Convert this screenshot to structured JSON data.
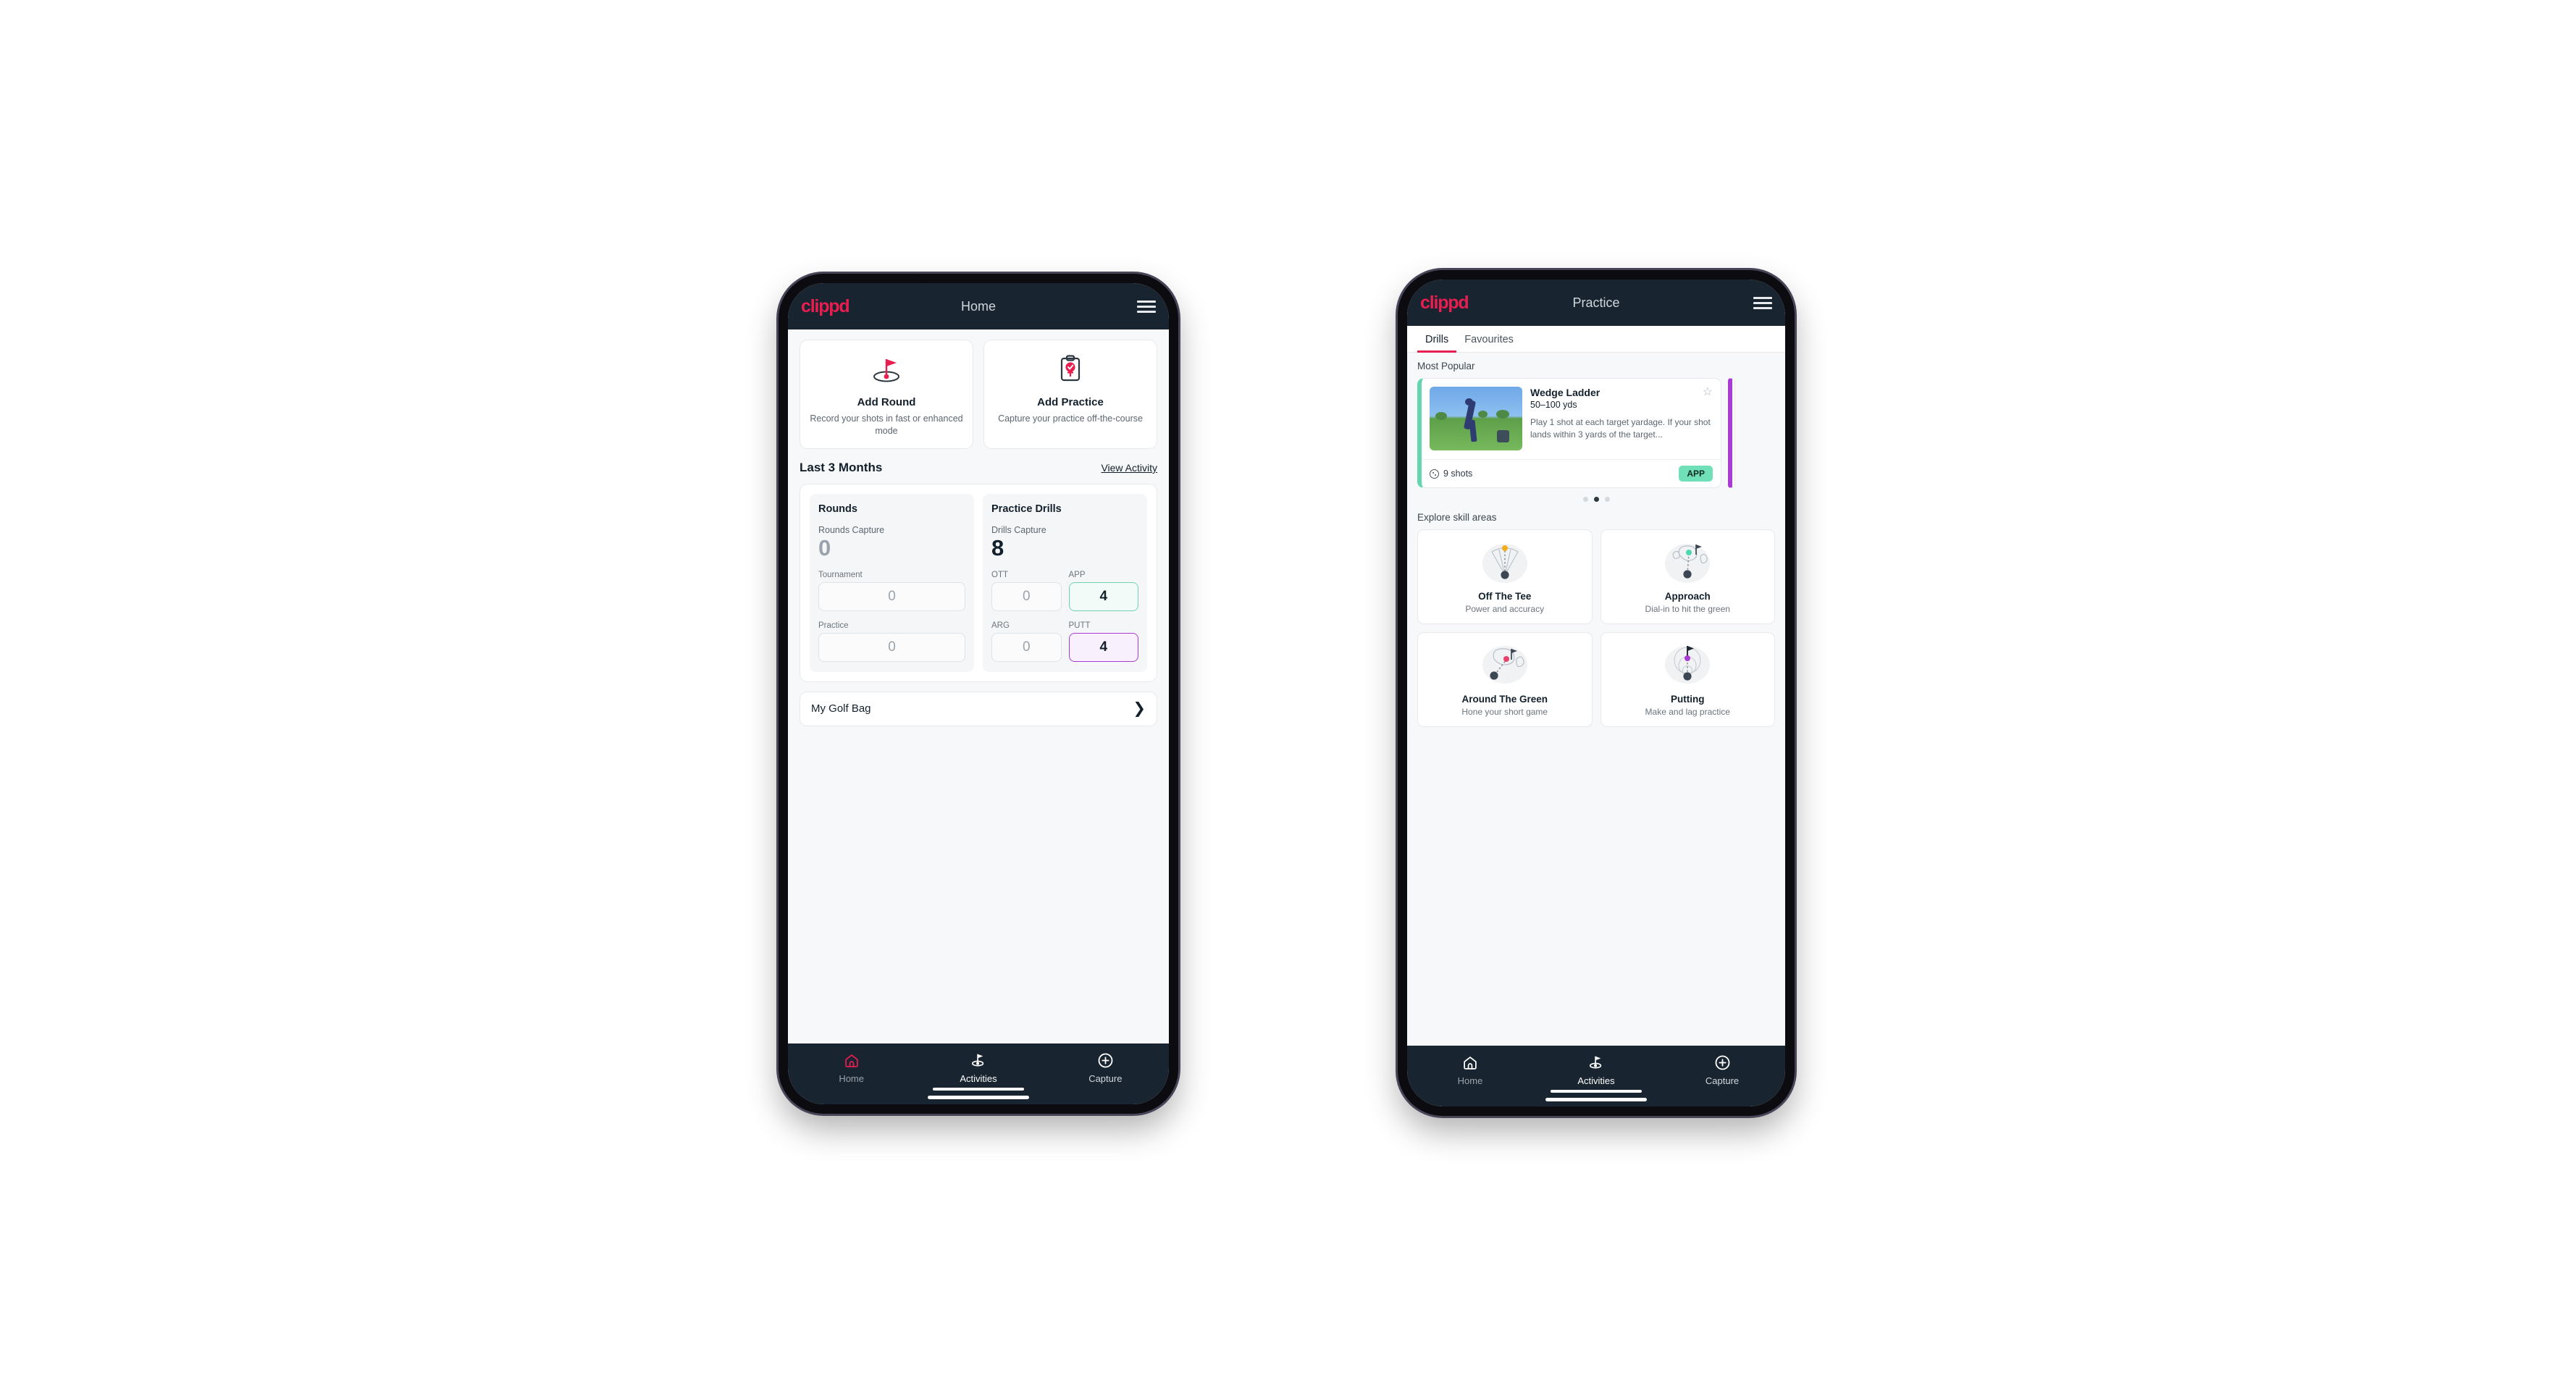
{
  "brand": {
    "logo_text": "clippd",
    "accent": "#e81e50",
    "dark": "#18242f"
  },
  "phone1": {
    "appbar": {
      "title": "Home",
      "menu_icon": "hamburger-icon"
    },
    "quick_actions": [
      {
        "icon": "golf-flag-hole-icon",
        "title": "Add Round",
        "subtitle": "Record your shots in fast or enhanced mode"
      },
      {
        "icon": "clipboard-check-icon",
        "title": "Add Practice",
        "subtitle": "Capture your practice off-the-course"
      }
    ],
    "section": {
      "title": "Last 3 Months",
      "link": "View Activity"
    },
    "rounds": {
      "heading": "Rounds",
      "caption": "Rounds Capture",
      "value": "0",
      "fields": [
        {
          "label": "Tournament",
          "value": "0",
          "state": "empty"
        },
        {
          "label": "Practice",
          "value": "0",
          "state": "empty"
        }
      ]
    },
    "drills": {
      "heading": "Practice Drills",
      "caption": "Drills Capture",
      "value": "8",
      "fields": [
        {
          "label": "OTT",
          "value": "0",
          "state": "empty"
        },
        {
          "label": "APP",
          "value": "4",
          "state": "app"
        },
        {
          "label": "ARG",
          "value": "0",
          "state": "empty"
        },
        {
          "label": "PUTT",
          "value": "4",
          "state": "putt"
        }
      ]
    },
    "golf_bag": {
      "label": "My Golf Bag",
      "chevron": "chevron-right-icon"
    },
    "bottom_nav": [
      {
        "icon": "home-icon",
        "label": "Home",
        "active": false
      },
      {
        "icon": "golf-flag-icon",
        "label": "Activities",
        "active": true
      },
      {
        "icon": "plus-circle-icon",
        "label": "Capture",
        "active": false
      }
    ]
  },
  "phone2": {
    "appbar": {
      "title": "Practice",
      "menu_icon": "hamburger-icon"
    },
    "tabs": [
      {
        "label": "Drills",
        "active": true
      },
      {
        "label": "Favourites",
        "active": false
      }
    ],
    "most_popular": {
      "heading": "Most Popular",
      "drill": {
        "title": "Wedge Ladder",
        "yardage": "50–100 yds",
        "description": "Play 1 shot at each target yardage. If your shot lands within 3 yards of the target...",
        "shots": "9 shots",
        "tag": "APP",
        "favourite_icon": "star-outline-icon",
        "accent": "#63d6b0"
      },
      "dots": [
        false,
        true,
        false
      ]
    },
    "skill_areas": {
      "heading": "Explore skill areas",
      "cards": [
        {
          "icon": "tee-fan-icon",
          "name": "Off The Tee",
          "sub": "Power and accuracy",
          "dot": "#f0ad1e"
        },
        {
          "icon": "green-approach-icon",
          "name": "Approach",
          "sub": "Dial-in to hit the green",
          "dot": "#4ed6ae"
        },
        {
          "icon": "chip-green-icon",
          "name": "Around The Green",
          "sub": "Hone your short game",
          "dot": "#e8426b"
        },
        {
          "icon": "putting-rings-icon",
          "name": "Putting",
          "sub": "Make and lag practice",
          "dot": "#a93ad4"
        }
      ]
    },
    "bottom_nav": [
      {
        "icon": "home-icon",
        "label": "Home",
        "active": false
      },
      {
        "icon": "golf-flag-icon",
        "label": "Activities",
        "active": true
      },
      {
        "icon": "plus-circle-icon",
        "label": "Capture",
        "active": false
      }
    ]
  }
}
